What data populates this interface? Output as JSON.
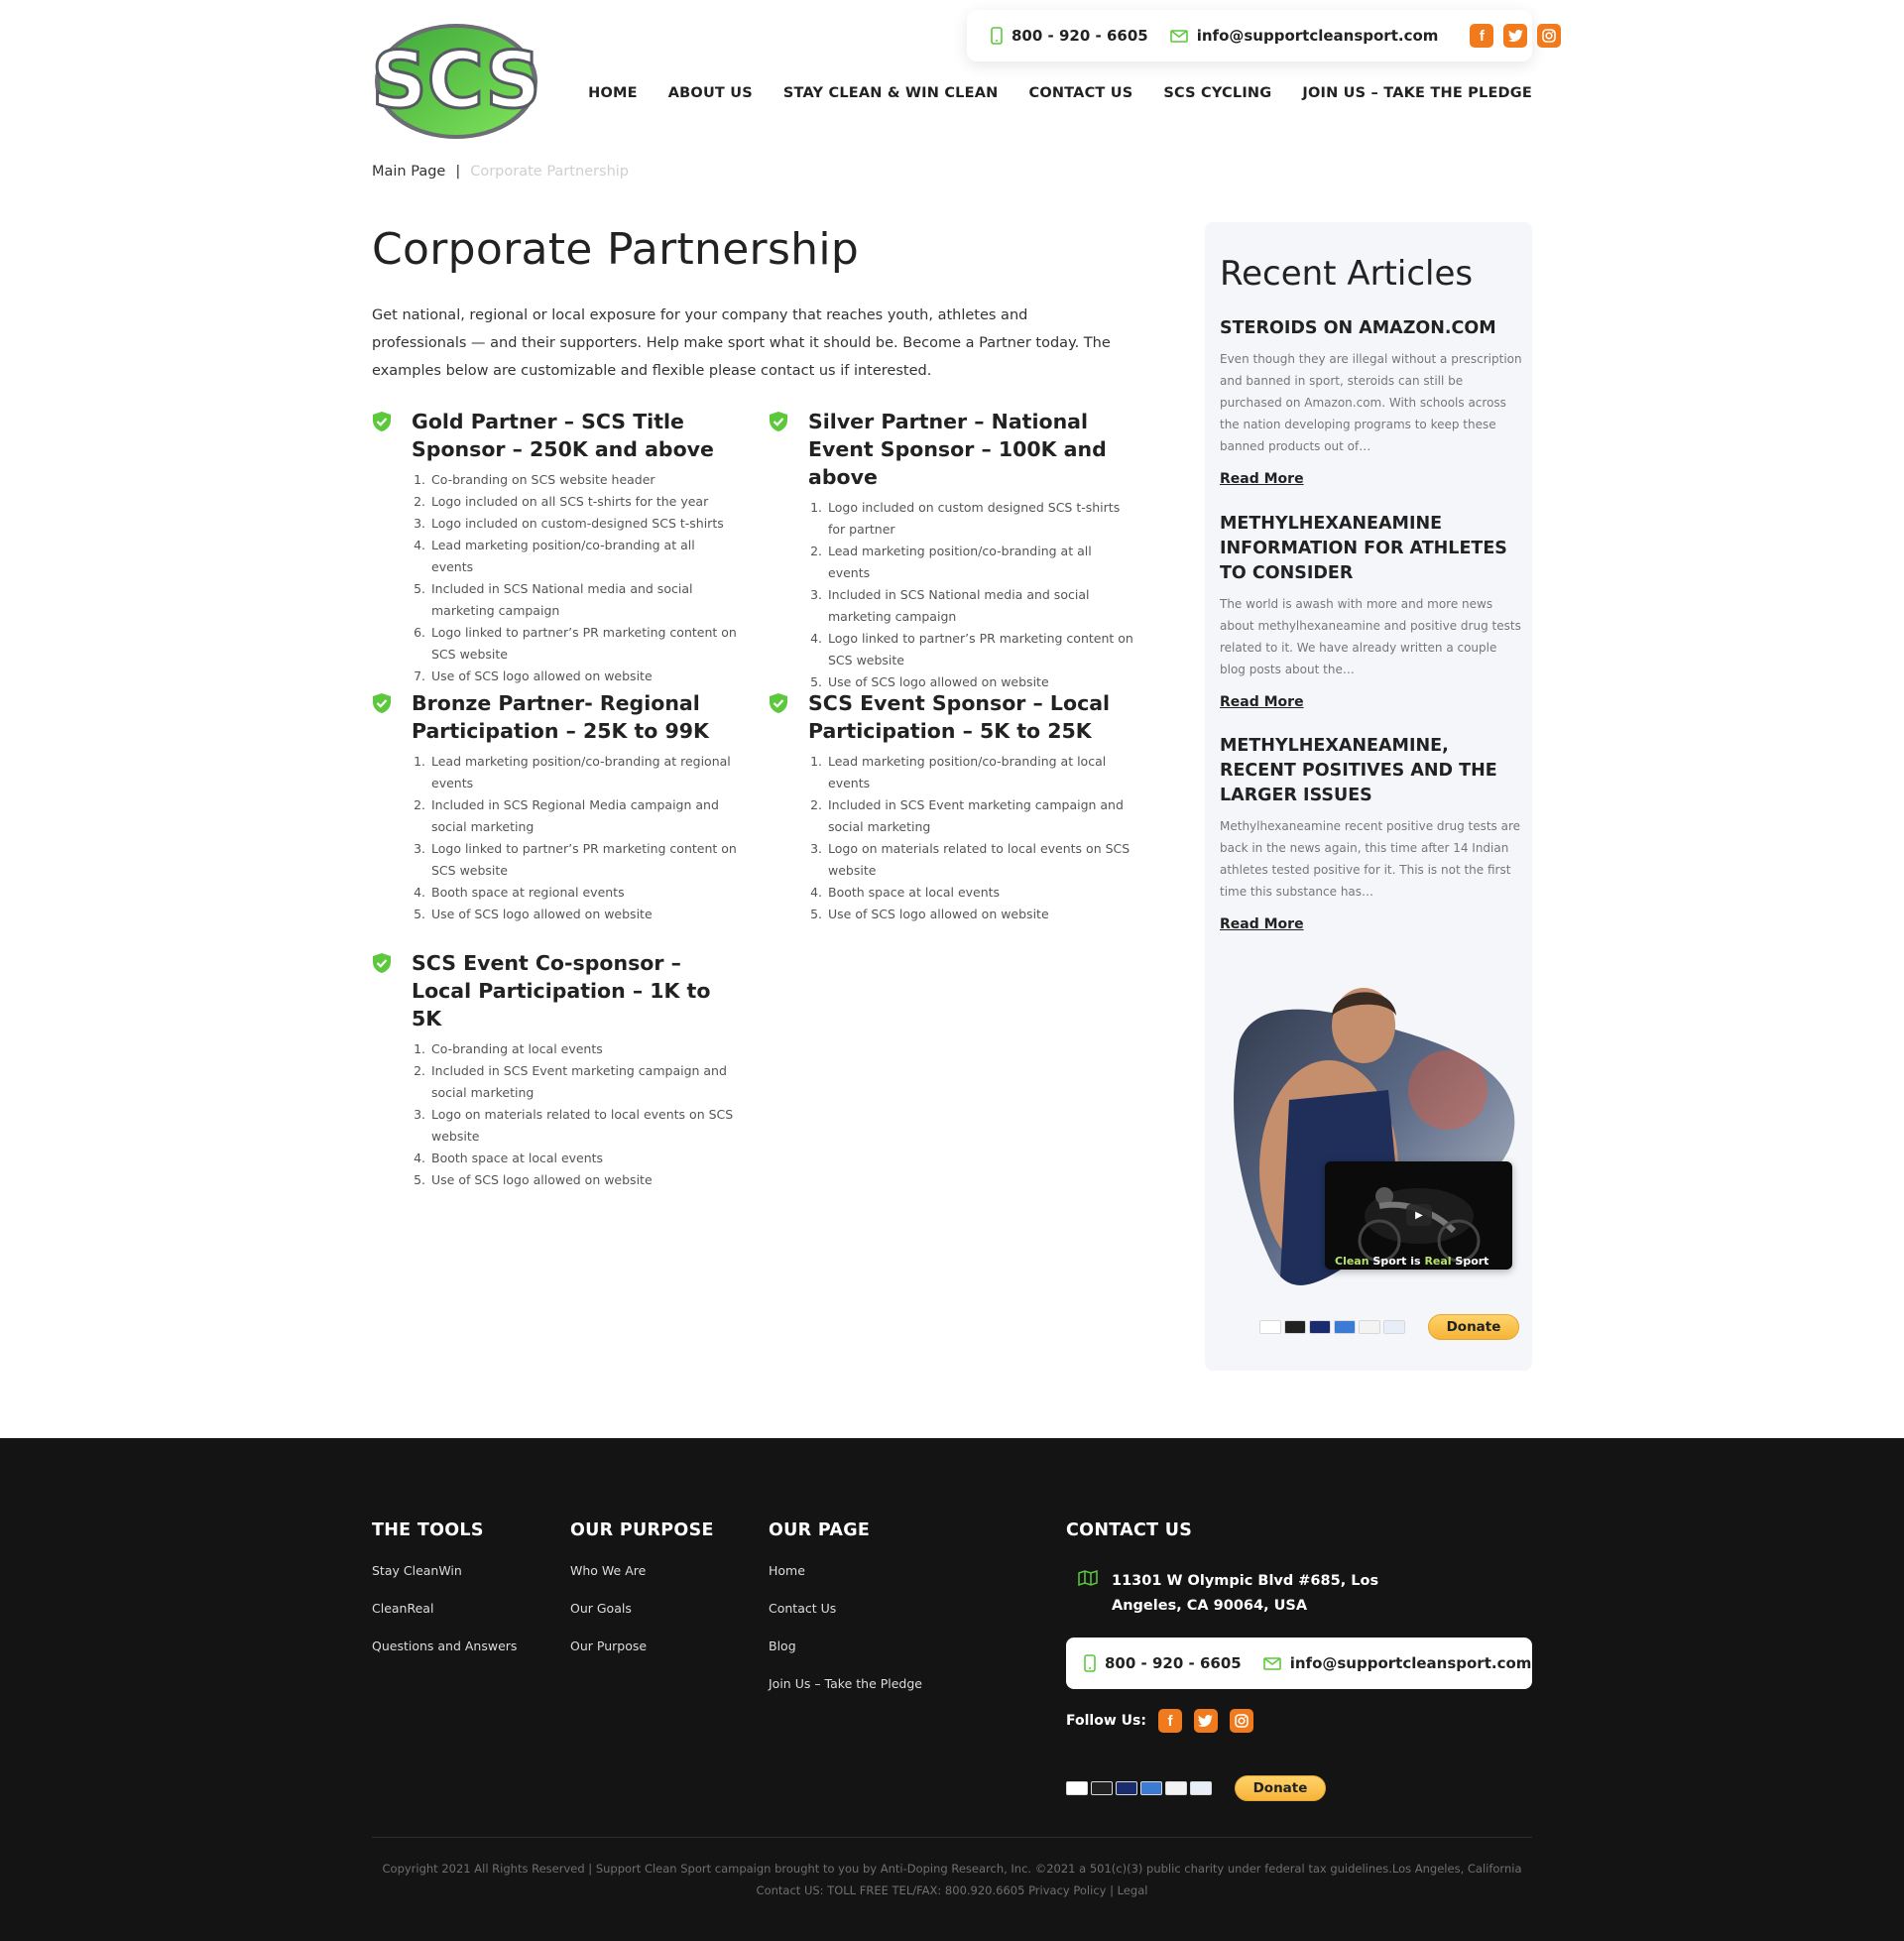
{
  "header": {
    "phone": "800 - 920 - 6605",
    "email": "info@supportcleansport.com",
    "nav": [
      "HOME",
      "ABOUT US",
      "STAY CLEAN & WIN CLEAN",
      "CONTACT US",
      "SCS CYCLING",
      "JOIN US – TAKE THE PLEDGE"
    ],
    "socials": [
      "facebook-icon",
      "twitter-icon",
      "instagram-icon"
    ],
    "accent": "#f07a1c",
    "brand_green": "#5cc93c",
    "logo_text": "SCS"
  },
  "breadcrumb": {
    "home": "Main Page",
    "sep": "|",
    "current": "Corporate Partnership"
  },
  "main": {
    "title": "Corporate Partnership",
    "intro": "Get national, regional or local exposure for your company that reaches youth, athletes and professionals — and their supporters. Help make sport what it should be. Become a Partner today. The examples below are customizable and flexible please contact us if interested.",
    "tiers": [
      {
        "title": "Gold Partner – SCS Title Sponsor – 250K and above",
        "items": [
          "Co-branding on SCS website header",
          "Logo included on all SCS t-shirts for the year",
          "Logo included on custom-designed SCS t-shirts",
          "Lead marketing position/co-branding at all events",
          "Included in SCS National media and social marketing campaign",
          "Logo linked to partner’s PR marketing content on SCS website",
          "Use of SCS logo allowed on website"
        ]
      },
      {
        "title": "Silver Partner – National Event Sponsor – 100K and above",
        "items": [
          "Logo included on custom designed SCS t-shirts for partner",
          "Lead marketing position/co-branding at all events",
          "Included in SCS National media and social marketing campaign",
          "Logo linked to partner’s PR marketing content on SCS website",
          "Use of SCS logo allowed on website"
        ]
      },
      {
        "title": "Bronze Partner- Regional Participation – 25K to 99K",
        "items": [
          "Lead marketing position/co-branding at regional events",
          "Included in SCS Regional Media campaign and social marketing",
          "Logo linked to partner’s PR marketing content on SCS website",
          "Booth space at regional events",
          "Use of SCS logo allowed on website"
        ]
      },
      {
        "title": "SCS Event Sponsor – Local Participation – 5K to 25K",
        "items": [
          "Lead marketing position/co-branding at local events",
          "Included in SCS Event marketing campaign and social marketing",
          "Logo on materials related to local events on SCS website",
          "Booth space at local events",
          "Use of SCS logo allowed on website"
        ]
      },
      {
        "title": "SCS Event Co-sponsor – Local Participation – 1K to 5K",
        "items": [
          "Co-branding at local events",
          "Included in SCS Event marketing campaign and social marketing",
          "Logo on materials related to local events on SCS website",
          "Booth space at local events",
          "Use of SCS logo allowed on website"
        ]
      }
    ]
  },
  "sidebar": {
    "title": "Recent Articles",
    "articles": [
      {
        "title": "STEROIDS ON AMAZON.COM",
        "excerpt": "Even though they are illegal without a prescription and banned in sport, steroids can still be purchased on Amazon.com. With schools across the nation developing programs to keep these banned products out of…",
        "link": "Read More"
      },
      {
        "title": "METHYLHEXANEAMINE INFORMATION FOR ATHLETES TO CONSIDER",
        "excerpt": "The world is awash with more and more news about methylhexaneamine and positive drug tests related to it.  We have already written a couple blog posts about the…",
        "link": "Read More"
      },
      {
        "title": "METHYLHEXANEAMINE, RECENT POSITIVES AND THE LARGER ISSUES",
        "excerpt": "Methylhexaneamine recent positive drug tests are back in the news again, this time after 14 Indian athletes tested positive for it. This is not the first time this substance has…",
        "link": "Read More"
      }
    ],
    "video_caption": {
      "w1": "Clean",
      "w2": "Sport is",
      "w3": "Real",
      "w4": "Sport"
    },
    "donate": "Donate"
  },
  "footer": {
    "cols": [
      {
        "title": "THE TOOLS",
        "links": [
          "Stay CleanWin",
          "CleanReal",
          "Questions and Answers"
        ]
      },
      {
        "title": "OUR PURPOSE",
        "links": [
          "Who We Are",
          "Our Goals",
          "Our Purpose"
        ]
      },
      {
        "title": "OUR PAGE",
        "links": [
          "Home",
          "Contact Us",
          "Blog",
          "Join Us – Take the Pledge"
        ]
      }
    ],
    "contact_title": "CONTACT US",
    "address": "11301 W Olympic Blvd #685, Los Angeles, CA 90064, USA",
    "phone": "800 - 920 - 6605",
    "email": "info@supportcleansport.com",
    "follow": "Follow Us:",
    "donate": "Donate",
    "copyright": "Copyright 2021 All Rights Reserved | Support Clean Sport campaign brought to you by Anti-Doping Research, Inc. ©2021 a 501(c)(3) public charity under federal tax guidelines.Los Angeles, California Contact US: TOLL FREE TEL/FAX: 800.920.6605 Privacy Policy | Legal"
  }
}
